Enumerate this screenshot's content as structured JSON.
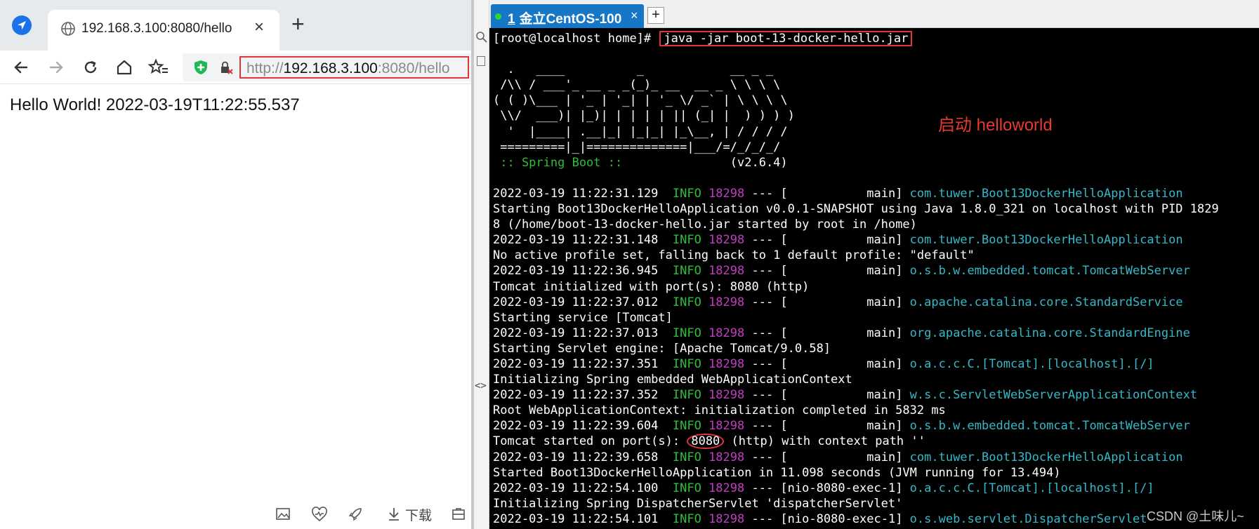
{
  "browser": {
    "tab_title": "192.168.3.100:8080/hello",
    "url": {
      "scheme": "http://",
      "host": "192.168.3.100",
      "rest": ":8080/hello"
    },
    "page_text": "Hello World! 2022-03-19T11:22:55.537",
    "download_label": "下载",
    "icons": [
      "browser-logo-icon",
      "globe-icon",
      "close-icon",
      "plus-icon",
      "back-icon",
      "forward-icon",
      "reload-icon",
      "home-icon",
      "favorites-icon",
      "shield-icon",
      "lock-icon",
      "image-icon",
      "heart-icon",
      "rocket-icon",
      "download-icon",
      "tools-icon"
    ]
  },
  "terminal_app": {
    "tab_number": "1",
    "tab_label": "金立CentOS-100",
    "tab_close": "×",
    "new_tab": "+",
    "side_toggle": "<>"
  },
  "terminal": {
    "prompt": "[root@localhost home]# ",
    "command": "java -jar boot-13-docker-hello.jar",
    "banner": [
      "",
      "  .   ____          _            __ _ _",
      " /\\\\ / ___'_ __ _ _(_)_ __  __ _ \\ \\ \\ \\",
      "( ( )\\___ | '_ | '_| | '_ \\/ _` | \\ \\ \\ \\",
      " \\\\/  ___)| |_)| | | | | || (_| |  ) ) ) )",
      "  '  |____| .__|_| |_|_| |_\\__, | / / / /",
      " =========|_|==============|___/=/_/_/_/"
    ],
    "spring_line": " :: Spring Boot ::",
    "version": "(v2.6.4)",
    "logs": [
      {
        "ts": "2022-03-19 11:22:31.129",
        "level": "INFO",
        "pid": "18298",
        "thread": "           main]",
        "logger": "com.tuwer.Boot13DockerHelloApplication",
        "msg": [
          "Starting Boot13DockerHelloApplication v0.0.1-SNAPSHOT using Java 1.8.0_321 on localhost with PID 1829",
          "8 (/home/boot-13-docker-hello.jar started by root in /home)"
        ]
      },
      {
        "ts": "2022-03-19 11:22:31.148",
        "level": "INFO",
        "pid": "18298",
        "thread": "           main]",
        "logger": "com.tuwer.Boot13DockerHelloApplication",
        "msg": [
          "No active profile set, falling back to 1 default profile: \"default\""
        ]
      },
      {
        "ts": "2022-03-19 11:22:36.945",
        "level": "INFO",
        "pid": "18298",
        "thread": "           main]",
        "logger": "o.s.b.w.embedded.tomcat.TomcatWebServer",
        "msg": [
          "Tomcat initialized with port(s): 8080 (http)"
        ]
      },
      {
        "ts": "2022-03-19 11:22:37.012",
        "level": "INFO",
        "pid": "18298",
        "thread": "           main]",
        "logger": "o.apache.catalina.core.StandardService",
        "msg": [
          "Starting service [Tomcat]"
        ]
      },
      {
        "ts": "2022-03-19 11:22:37.013",
        "level": "INFO",
        "pid": "18298",
        "thread": "           main]",
        "logger": "org.apache.catalina.core.StandardEngine",
        "msg": [
          "Starting Servlet engine: [Apache Tomcat/9.0.58]"
        ]
      },
      {
        "ts": "2022-03-19 11:22:37.351",
        "level": "INFO",
        "pid": "18298",
        "thread": "           main]",
        "logger": "o.a.c.c.C.[Tomcat].[localhost].[/]",
        "msg": [
          "Initializing Spring embedded WebApplicationContext"
        ]
      },
      {
        "ts": "2022-03-19 11:22:37.352",
        "level": "INFO",
        "pid": "18298",
        "thread": "           main]",
        "logger": "w.s.c.ServletWebServerApplicationContext",
        "msg": [
          "Root WebApplicationContext: initialization completed in 5832 ms"
        ]
      },
      {
        "ts": "2022-03-19 11:22:39.604",
        "level": "INFO",
        "pid": "18298",
        "thread": "           main]",
        "logger": "o.s.b.w.embedded.tomcat.TomcatWebServer",
        "msg": [],
        "port_line": {
          "before": "Tomcat started on port(s): ",
          "port": "8080",
          "after": " (http) with context path ''"
        }
      },
      {
        "ts": "2022-03-19 11:22:39.658",
        "level": "INFO",
        "pid": "18298",
        "thread": "           main]",
        "logger": "com.tuwer.Boot13DockerHelloApplication",
        "msg": [
          "Started Boot13DockerHelloApplication in 11.098 seconds (JVM running for 13.494)"
        ]
      },
      {
        "ts": "2022-03-19 11:22:54.100",
        "level": "INFO",
        "pid": "18298",
        "thread": "[nio-8080-exec-1]",
        "logger": "o.a.c.c.C.[Tomcat].[localhost].[/]",
        "msg": [
          "Initializing Spring DispatcherServlet 'dispatcherServlet'"
        ]
      },
      {
        "ts": "2022-03-19 11:22:54.101",
        "level": "INFO",
        "pid": "18298",
        "thread": "[nio-8080-exec-1]",
        "logger": "o.s.web.servlet.DispatcherServlet",
        "msg": []
      }
    ]
  },
  "annotation": "启动 helloworld",
  "watermark": "CSDN @土味儿~",
  "colors": {
    "highlight_red": "#e0363b",
    "info_green": "#2dbd3a",
    "pid_magenta": "#c23bc2",
    "logger_cyan": "#35b8c8",
    "tab_blue": "#1677c7",
    "terminal_bg": "#000000"
  }
}
